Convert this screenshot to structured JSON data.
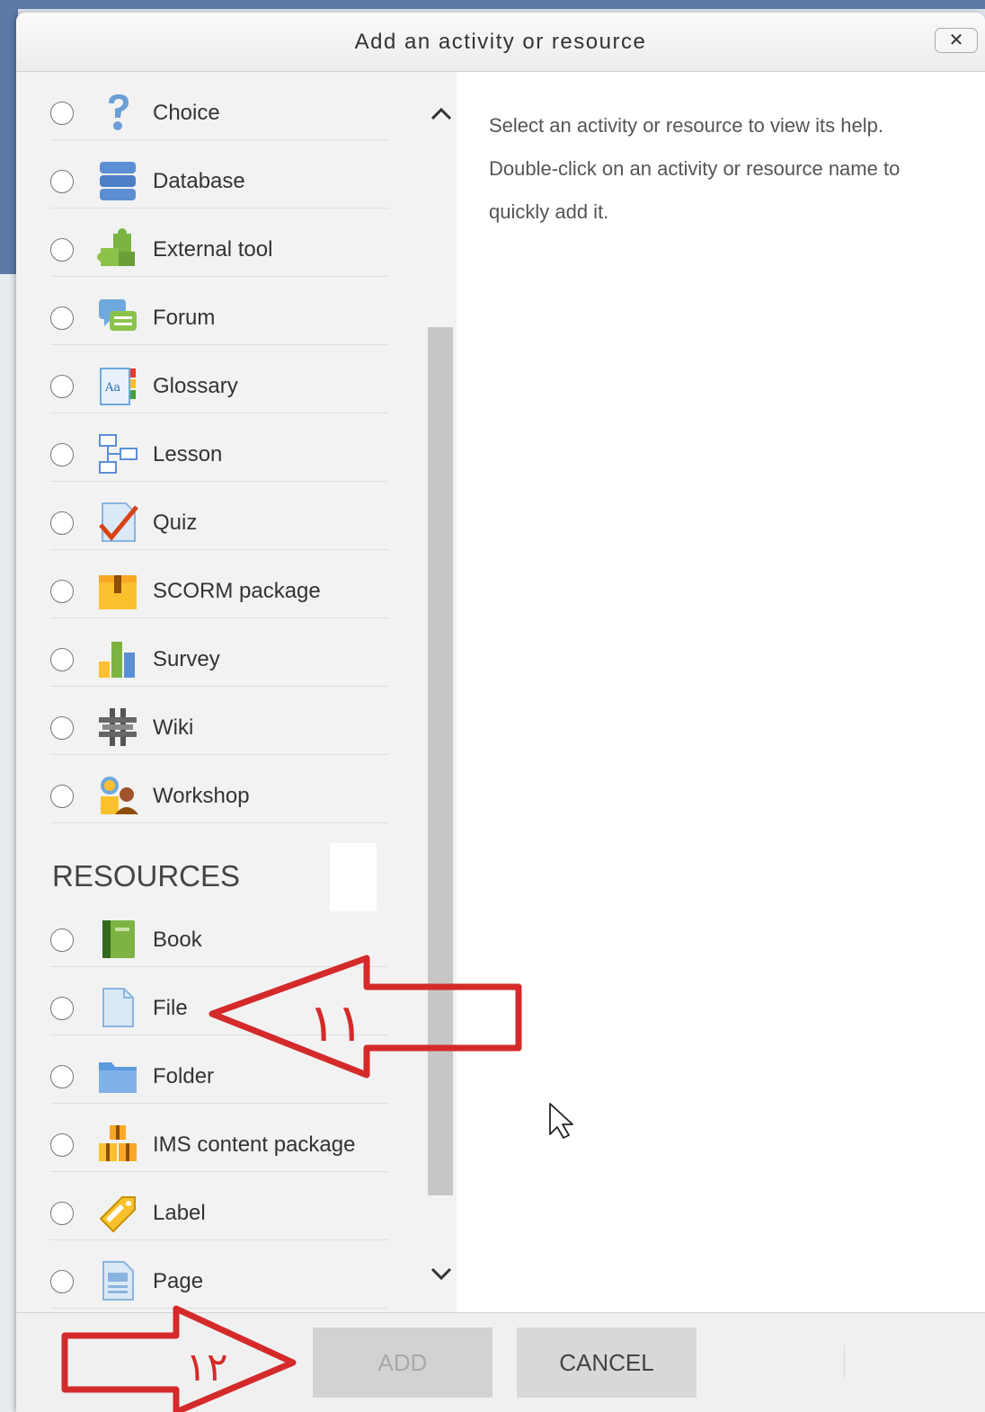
{
  "dialog": {
    "title": "Add an activity or resource",
    "close_label": "✕"
  },
  "activities": [
    {
      "label": "Choice",
      "icon": "choice-icon"
    },
    {
      "label": "Database",
      "icon": "database-icon"
    },
    {
      "label": "External tool",
      "icon": "external-tool-icon"
    },
    {
      "label": "Forum",
      "icon": "forum-icon"
    },
    {
      "label": "Glossary",
      "icon": "glossary-icon"
    },
    {
      "label": "Lesson",
      "icon": "lesson-icon"
    },
    {
      "label": "Quiz",
      "icon": "quiz-icon"
    },
    {
      "label": "SCORM package",
      "icon": "scorm-icon"
    },
    {
      "label": "Survey",
      "icon": "survey-icon"
    },
    {
      "label": "Wiki",
      "icon": "wiki-icon"
    },
    {
      "label": "Workshop",
      "icon": "workshop-icon"
    }
  ],
  "resources_heading": "RESOURCES",
  "resources": [
    {
      "label": "Book",
      "icon": "book-icon"
    },
    {
      "label": "File",
      "icon": "file-icon"
    },
    {
      "label": "Folder",
      "icon": "folder-icon"
    },
    {
      "label": "IMS content package",
      "icon": "ims-package-icon"
    },
    {
      "label": "Label",
      "icon": "label-icon"
    },
    {
      "label": "Page",
      "icon": "page-icon"
    }
  ],
  "help": {
    "text": "Select an activity or resource to view its help. Double-click on an activity or resource name to quickly add it."
  },
  "footer": {
    "add_label": "ADD",
    "cancel_label": "CANCEL"
  },
  "annotations": {
    "arrow_file_number": "۱۱",
    "arrow_add_number": "۱۲"
  },
  "colors": {
    "annotation_red": "#d42a2a",
    "header_gradient_top": "#fbfbfb",
    "list_background": "#f2f2f2",
    "button_background": "#d2d2d2"
  }
}
